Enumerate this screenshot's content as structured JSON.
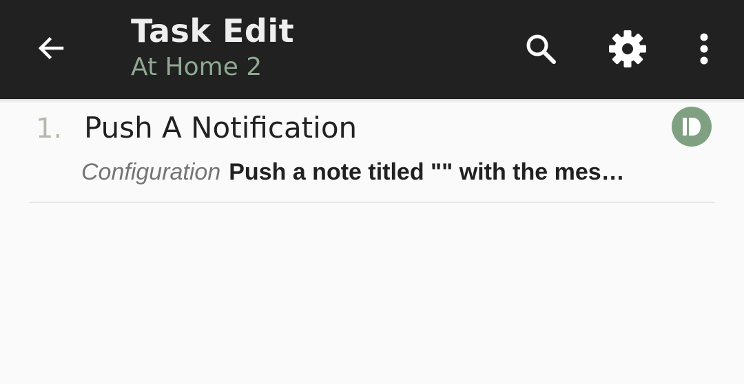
{
  "appbar": {
    "title": "Task Edit",
    "subtitle": "At Home 2",
    "back_icon": "arrow-left-icon",
    "search_icon": "search-icon",
    "settings_icon": "gear-icon",
    "more_icon": "more-vert-icon"
  },
  "actions": [
    {
      "number": "1.",
      "name": "Push A Notification",
      "config_label": "Configuration",
      "config_value": "Push a note titled \"\" with the mes…",
      "plugin_icon": "pushbullet-icon"
    }
  ],
  "colors": {
    "appbar_bg": "#212121",
    "title": "#eeeeee",
    "subtitle": "#8fa892",
    "plugin_badge": "#7fa181",
    "background": "#fafafa"
  }
}
